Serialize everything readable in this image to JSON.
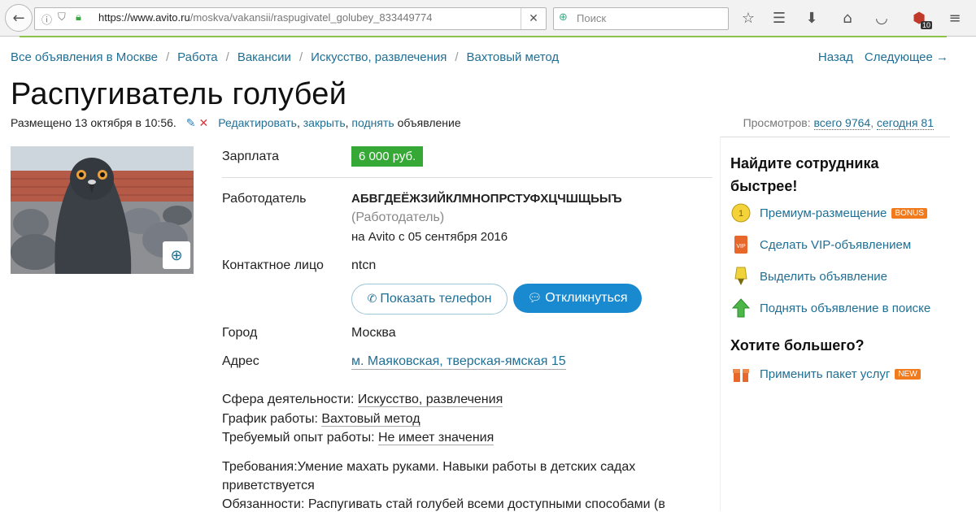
{
  "browser": {
    "url_host": "https://www.avito.ru",
    "url_path": "/moskva/vakansii/raspugivatel_golubey_833449774",
    "search_placeholder": "Поиск",
    "notification_count": "10"
  },
  "breadcrumbs": [
    "Все объявления в Москве",
    "Работа",
    "Вакансии",
    "Искусство, развлечения",
    "Вахтовый метод"
  ],
  "nav": {
    "back": "Назад",
    "next": "Следующее →"
  },
  "title": "Распугиватель голубей",
  "posted": "Размещено 13 октября в 10:56.",
  "actions": {
    "edit": "Редактировать",
    "close": "закрыть",
    "raise": "поднять",
    "suffix": "объявление"
  },
  "views": {
    "label": "Просмотров:",
    "total": "всего 9764",
    "today": "сегодня 81"
  },
  "details": {
    "salary_label": "Зарплата",
    "salary_value": "6 000 руб.",
    "employer_label": "Работодатель",
    "employer_name": "АБВГДЕЁЖЗИЙКЛМНОПРСТУФХЦЧШЩЬЫЪ",
    "employer_type": "(Работодатель)",
    "employer_since": "на Avito с 05 сентября 2016",
    "contact_label": "Контактное лицо",
    "contact_value": "ntcn",
    "show_phone": "Показать телефон",
    "respond": "Откликнуться",
    "city_label": "Город",
    "city_value": "Москва",
    "address_label": "Адрес",
    "address_value": "м. Маяковская, тверская-ямская 15",
    "sphere_label": "Сфера деятельности:",
    "sphere_value": "Искусство, развлечения",
    "schedule_label": "График работы:",
    "schedule_value": "Вахтовый метод",
    "experience_label": "Требуемый опыт работы:",
    "experience_value": "Не имеет значения",
    "requirements_line1": "Требования:Умение махать руками. Навыки работы в детских садах",
    "requirements_line2": "приветствуется",
    "duties": "Обязанности: Распугивать стай голубей всеми доступными способами (в"
  },
  "sidebar": {
    "title_line1": "Найдите сотрудника",
    "title_line2": "быстрее!",
    "items": [
      {
        "label": "Премиум-размещение",
        "tag": "BONUS"
      },
      {
        "label": "Сделать VIP-объявлением"
      },
      {
        "label": "Выделить объявление"
      },
      {
        "label": "Поднять объявление в поиске"
      }
    ],
    "more_title": "Хотите большего?",
    "package": {
      "label": "Применить пакет услуг",
      "tag": "NEW"
    }
  }
}
